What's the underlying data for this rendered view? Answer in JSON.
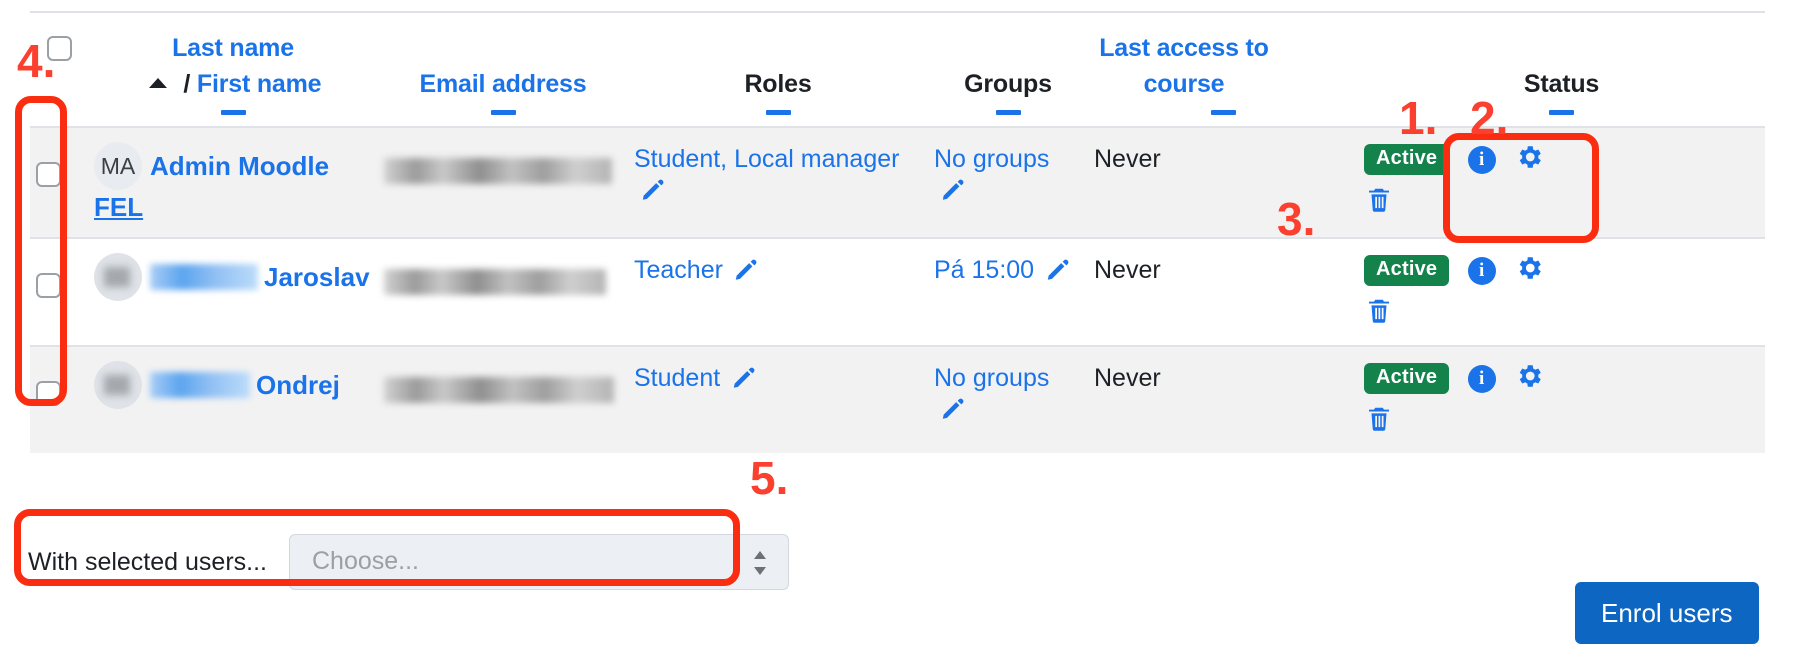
{
  "table": {
    "headers": {
      "select_all_checkbox": "select-all",
      "name": {
        "last": "Last name",
        "separator": "/",
        "first": "First name",
        "sort": "ascending"
      },
      "email": "Email address",
      "roles": "Roles",
      "groups": "Groups",
      "last_access": "Last access to course",
      "status": "Status"
    },
    "rows": [
      {
        "checked": false,
        "avatar_initials": "MA",
        "avatar_blurred": false,
        "name_line1": "Admin Moodle",
        "name_line2": "FEL",
        "name_blurred": false,
        "email_redacted": true,
        "roles": "Student, Local manager",
        "groups": "No groups",
        "last_access": "Never",
        "status": "Active"
      },
      {
        "checked": false,
        "avatar_initials": "",
        "avatar_blurred": true,
        "name_line1": "Jaroslav",
        "name_line2": "",
        "name_blurred": true,
        "email_redacted": true,
        "roles": "Teacher",
        "groups": "Pá 15:00",
        "last_access": "Never",
        "status": "Active"
      },
      {
        "checked": false,
        "avatar_initials": "",
        "avatar_blurred": true,
        "name_line1": "Ondrej",
        "name_line2": "",
        "name_blurred": true,
        "email_redacted": true,
        "roles": "Student",
        "groups": "No groups",
        "last_access": "Never",
        "status": "Active"
      }
    ]
  },
  "bulk": {
    "label": "With selected users...",
    "select_placeholder": "Choose...",
    "select_value": ""
  },
  "actions": {
    "enrol_users": "Enrol users"
  },
  "annotations": {
    "one": "1.",
    "two": "2.",
    "three": "3.",
    "four": "4.",
    "five": "5."
  },
  "colors": {
    "link": "#1a73e8",
    "active_badge": "#13824b",
    "annotation_red": "#fb2d10",
    "primary_button": "#0d66c2",
    "row_stripe": "#f2f2f3"
  },
  "icons": {
    "edit": "pencil-icon",
    "info": "info-icon",
    "settings": "gear-icon",
    "delete": "trash-icon",
    "sort": "sort-ascending-icon",
    "select_stepper": "up-down-chevron-icon"
  }
}
